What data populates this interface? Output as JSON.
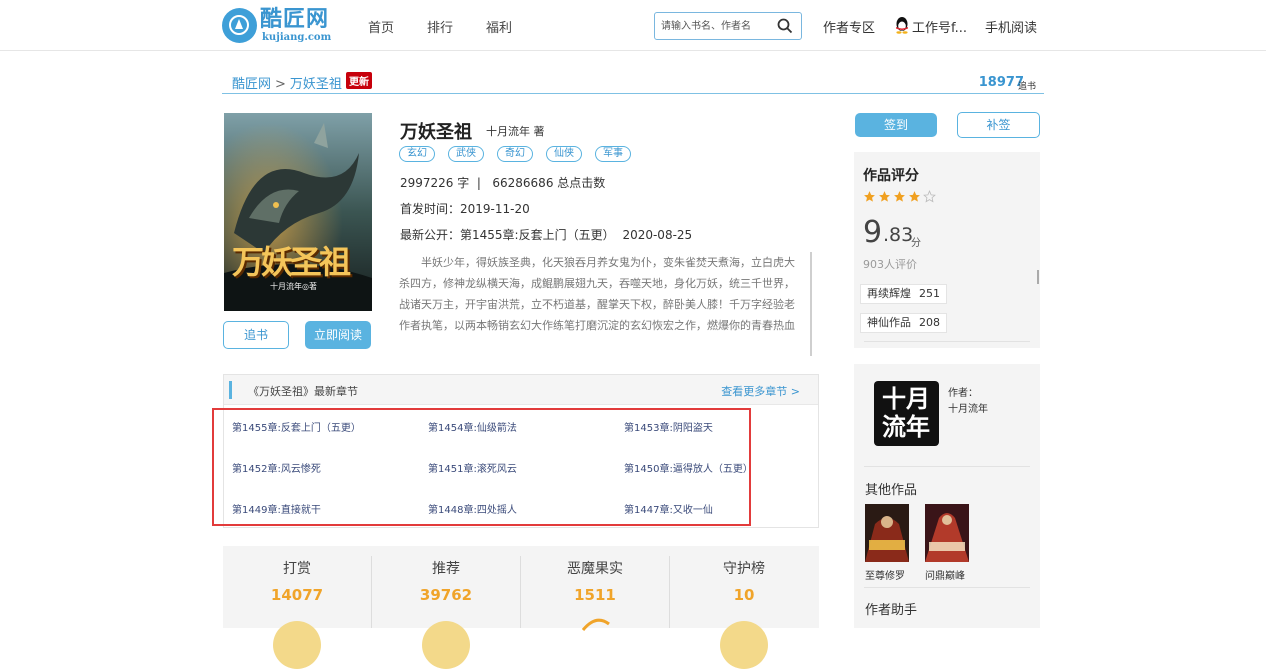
{
  "header": {
    "logo_cn": "酷匠网",
    "logo_en": "kujiang.com",
    "nav": [
      "首页",
      "排行",
      "福利"
    ],
    "search_placeholder": "请输入书名、作者名",
    "author_zone": "作者专区",
    "user_name": "工作号f...",
    "mobile_read": "手机阅读"
  },
  "breadcrumb": {
    "home": "酷匠网",
    "separator": ">",
    "book": "万妖圣祖",
    "badge": "更新",
    "follow_count": "18977",
    "follow_unit": "追书"
  },
  "book": {
    "cover_title": "万妖圣祖",
    "cover_author": "十月流年◎著",
    "title": "万妖圣祖",
    "author": "十月流年 著",
    "tags": [
      "玄幻",
      "武侠",
      "奇幻",
      "仙侠",
      "军事"
    ],
    "stats_line": "2997226 字  |   66286686 总点击数",
    "first_published": "首发时间：2019-11-20",
    "latest_prefix": "最新公开：",
    "latest_chapter": "第1455章:反套上门（五更）",
    "latest_date": "2020-08-25",
    "description": "半妖少年，得妖族圣典，化天狼吞月养女鬼为仆，变朱雀焚天煮海，立白虎大杀四方，修神龙纵横天海，成鲲鹏展翅九天，吞噬天地，身化万妖，统三千世界，战诸天万主，开宇宙洪荒，立不朽道基，醒掌天下权，醉卧美人膝！千万字经验老作者执笔，以两本畅销玄幻大作练笔打磨沉淀的玄幻恢宏之作，燃爆你的青春热血",
    "follow_button": "追书",
    "read_button": "立即阅读"
  },
  "chapters": {
    "heading": "《万妖圣祖》最新章节",
    "more": "查看更多章节 >",
    "items": [
      "第1455章:反套上门（五更）",
      "第1454章:仙级箭法",
      "第1453章:阴阳盗天",
      "第1452章:风云惨死",
      "第1451章:滚死风云",
      "第1450章:逼得放人（五更）",
      "第1449章:直接就干",
      "第1448章:四处摇人",
      "第1447章:又收一仙"
    ]
  },
  "stats": [
    {
      "label": "打赏",
      "value": "14077"
    },
    {
      "label": "推荐",
      "value": "39762"
    },
    {
      "label": "恶魔果实",
      "value": "1511"
    },
    {
      "label": "守护榜",
      "value": "10"
    }
  ],
  "sidebar": {
    "sign_button": "签到",
    "resign_button": "补签",
    "rating_title": "作品评分",
    "star_rating": 4,
    "star_total": 5,
    "score_int": "9",
    "score_dec": ".83",
    "score_unit": "分",
    "rating_count": "903人评价",
    "badges": [
      {
        "name": "再续辉煌",
        "count": "251"
      },
      {
        "name": "神仙作品",
        "count": "208"
      }
    ],
    "author_label": "作者：",
    "author_name": "十月流年",
    "avatar_text": "十月流年",
    "other_works_title": "其他作品",
    "other_works": [
      "至尊修罗",
      "问鼎巅峰"
    ],
    "assistant_title": "作者助手"
  },
  "colors": {
    "accent": "#5ab3e0",
    "link": "#3a95d0",
    "highlight_frame": "#e23b3b",
    "stat_value": "#f0a42a",
    "new_badge": "#c7000b",
    "star": "#f0a020"
  }
}
